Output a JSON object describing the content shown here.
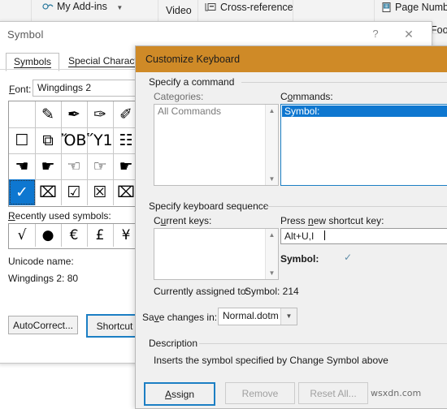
{
  "ribbon": {
    "items": [
      {
        "label": "My Add-ins",
        "icon": "addins-icon",
        "has_dropdown": true
      },
      {
        "label": "Video",
        "icon": "",
        "has_dropdown": false
      },
      {
        "label": "Cross-reference",
        "icon": "cross-reference-icon",
        "has_dropdown": false
      },
      {
        "label": "Page Numb",
        "icon": "page-number-icon",
        "has_dropdown": false
      },
      {
        "label": "Foo",
        "icon": "",
        "has_dropdown": false
      }
    ]
  },
  "symbol_dialog": {
    "title": "Symbol",
    "help_glyph": "?",
    "close_glyph": "✕",
    "tabs": [
      {
        "label": "Symbols",
        "active": true
      },
      {
        "label": "Special Characters",
        "active": false
      }
    ],
    "font": {
      "label": "Font:",
      "value": "Wingdings 2"
    },
    "grid": {
      "rows": [
        [
          "",
          "✎",
          "✒",
          "✑",
          "✐"
        ],
        [
          "☐",
          "⧉",
          "ὌB",
          "Ὕ1",
          "☷"
        ],
        [
          "☚",
          "☛",
          "☜",
          "☞",
          "☛"
        ],
        [
          "✓",
          "⌧",
          "☑",
          "☒",
          "⌧"
        ]
      ],
      "selected": {
        "row": 3,
        "col": 0
      }
    },
    "recent": {
      "label": "Recently used symbols:",
      "symbols": [
        "√",
        "●",
        "€",
        "£",
        "¥"
      ]
    },
    "unicode": {
      "label": "Unicode name:",
      "value": "Wingdings 2: 80"
    },
    "buttons": {
      "autocorrect": "AutoCorrect...",
      "shortcut": "Shortcut"
    }
  },
  "customize_keyboard": {
    "title": "Customize Keyboard",
    "specify_command": {
      "group_label": "Specify a command",
      "categories_label": "Categories:",
      "categories_items": [
        "All Commands"
      ],
      "commands_label": "Commands:",
      "commands_items": [
        "Symbol:"
      ],
      "commands_selected": "Symbol:"
    },
    "specify_sequence": {
      "group_label": "Specify keyboard sequence",
      "current_keys_label": "Current keys:",
      "current_keys_items": [],
      "press_new_label": "Press new shortcut key:",
      "press_new_value": "Alt+U,I",
      "symbol_label": "Symbol:",
      "symbol_glyph": "✓",
      "currently_assigned_label": "Currently assigned to:",
      "currently_assigned_value": "Symbol: 214"
    },
    "save_changes": {
      "label": "Save changes in:",
      "value": "Normal.dotm"
    },
    "description": {
      "group_label": "Description",
      "text": "Inserts the symbol specified by Change Symbol above"
    },
    "buttons": [
      {
        "label": "Assign",
        "state": "primary",
        "accesskey": "A"
      },
      {
        "label": "Remove",
        "state": "disabled"
      },
      {
        "label": "Reset All...",
        "state": "disabled"
      }
    ]
  },
  "watermark": "wsxdn.com",
  "colors": {
    "title_orange": "#cf8a27",
    "selection_blue": "#0e77d0",
    "focus_border": "#1c7fc4",
    "dialog_face": "#f0f0f0"
  }
}
